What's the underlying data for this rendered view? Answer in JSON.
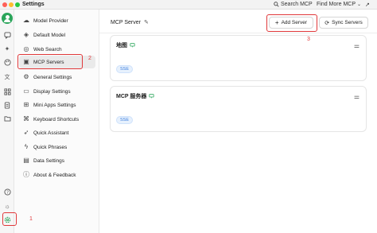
{
  "window": {
    "title": "Settings",
    "search_label": "Search MCP",
    "find_more_label": "Find More MCP"
  },
  "rail": {
    "icons": [
      "user-avatar-icon",
      "chat-icon",
      "sparkle-icon",
      "palette-icon",
      "translate-icon",
      "apps-grid-icon",
      "document-icon",
      "folder-icon",
      "help-icon",
      "brightness-icon",
      "settings-icon"
    ]
  },
  "menu": {
    "items": [
      {
        "label": "Model Provider",
        "icon": "cloud-icon"
      },
      {
        "label": "Default Model",
        "icon": "cube-icon"
      },
      {
        "label": "Web Search",
        "icon": "globe-icon"
      },
      {
        "label": "MCP Servers",
        "icon": "terminal-icon",
        "active": true
      },
      {
        "label": "General Settings",
        "icon": "gear-icon"
      },
      {
        "label": "Display Settings",
        "icon": "monitor-icon"
      },
      {
        "label": "Mini Apps Settings",
        "icon": "grid-icon"
      },
      {
        "label": "Keyboard Shortcuts",
        "icon": "command-icon"
      },
      {
        "label": "Quick Assistant",
        "icon": "rocket-icon"
      },
      {
        "label": "Quick Phrases",
        "icon": "zap-icon"
      },
      {
        "label": "Data Settings",
        "icon": "database-icon"
      },
      {
        "label": "About & Feedback",
        "icon": "info-icon"
      }
    ]
  },
  "main": {
    "title": "MCP Server",
    "add_server_label": "Add Server",
    "sync_servers_label": "Sync Servers",
    "servers": [
      {
        "name": "地图",
        "tag": "SSE"
      },
      {
        "name": "MCP 服务器",
        "tag": "SSE"
      }
    ]
  },
  "annotations": {
    "step1": "1",
    "step2": "2",
    "step3": "3",
    "highlight_color": "#e0383a"
  },
  "colors": {
    "accent_green": "#2ba55b",
    "tag_blue": "#3b7ddd"
  }
}
